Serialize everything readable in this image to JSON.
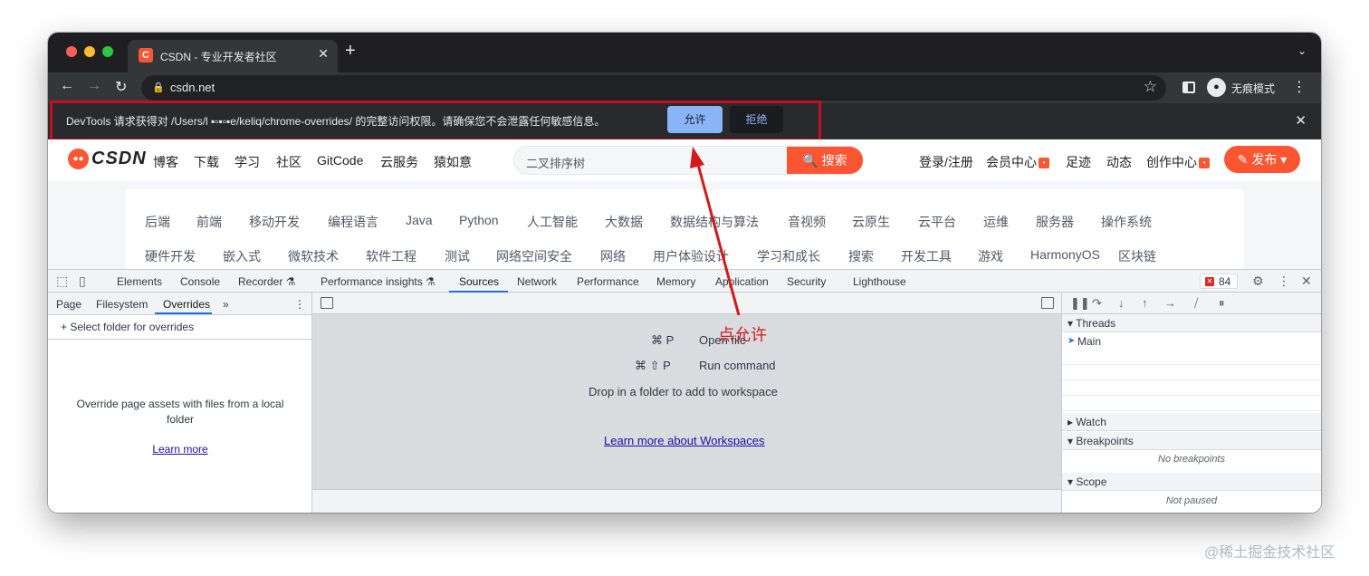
{
  "tab": {
    "favicon_letter": "C",
    "title": "CSDN - 专业开发者社区",
    "close": "✕"
  },
  "toolbar": {
    "url": "csdn.net",
    "incognito_label": "无痕模式"
  },
  "infobar": {
    "message": "DevTools 请求获得对 /Users/l ▪▫▪▫▪e/keliq/chrome-overrides/ 的完整访问权限。请确保您不会泄露任何敏感信息。",
    "allow": "允许",
    "deny": "拒绝"
  },
  "csdn": {
    "logo_text": "CSDN",
    "nav": [
      "博客",
      "下载",
      "学习",
      "社区",
      "GitCode",
      "云服务",
      "猿如意"
    ],
    "search_query": "二叉排序树",
    "search_button": "🔍 搜索",
    "right": [
      "登录/注册",
      "会员中心",
      "足迹",
      "动态",
      "创作中心"
    ],
    "publish": "发布",
    "categories_row1": [
      "后端",
      "前端",
      "移动开发",
      "编程语言",
      "Java",
      "Python",
      "人工智能",
      "大数据",
      "数据结构与算法",
      "音视频",
      "云原生",
      "云平台",
      "运维",
      "服务器",
      "操作系统"
    ],
    "categories_row2": [
      "硬件开发",
      "嵌入式",
      "微软技术",
      "软件工程",
      "测试",
      "网络空间安全",
      "网络",
      "用户体验设计",
      "学习和成长",
      "搜索",
      "开发工具",
      "游戏",
      "HarmonyOS",
      "区块链"
    ]
  },
  "devtools": {
    "tabs": [
      "Elements",
      "Console",
      "Recorder ⚗",
      "Performance insights ⚗",
      "Sources",
      "Network",
      "Performance",
      "Memory",
      "Application",
      "Security",
      "Lighthouse"
    ],
    "error_count": "84",
    "navigator_tabs": [
      "Page",
      "Filesystem",
      "Overrides",
      "»"
    ],
    "add_folder": "+ Select folder for overrides",
    "override_desc": "Override page assets with files from a local folder",
    "learn_more": "Learn more",
    "shortcuts": [
      {
        "keys": "⌘ P",
        "label": "Open file"
      },
      {
        "keys": "⌘ ⇧ P",
        "label": "Run command"
      }
    ],
    "drop_text": "Drop in a folder to add to workspace",
    "workspace_link": "Learn more about Workspaces",
    "threads_label": "Threads",
    "thread_main": "Main",
    "watch_label": "Watch",
    "breakpoints_label": "Breakpoints",
    "no_breakpoints": "No breakpoints",
    "scope_label": "Scope",
    "not_paused": "Not paused"
  },
  "annotation": {
    "label": "点允许",
    "color": "#d21a1a"
  },
  "watermark": "@稀土掘金技术社区"
}
